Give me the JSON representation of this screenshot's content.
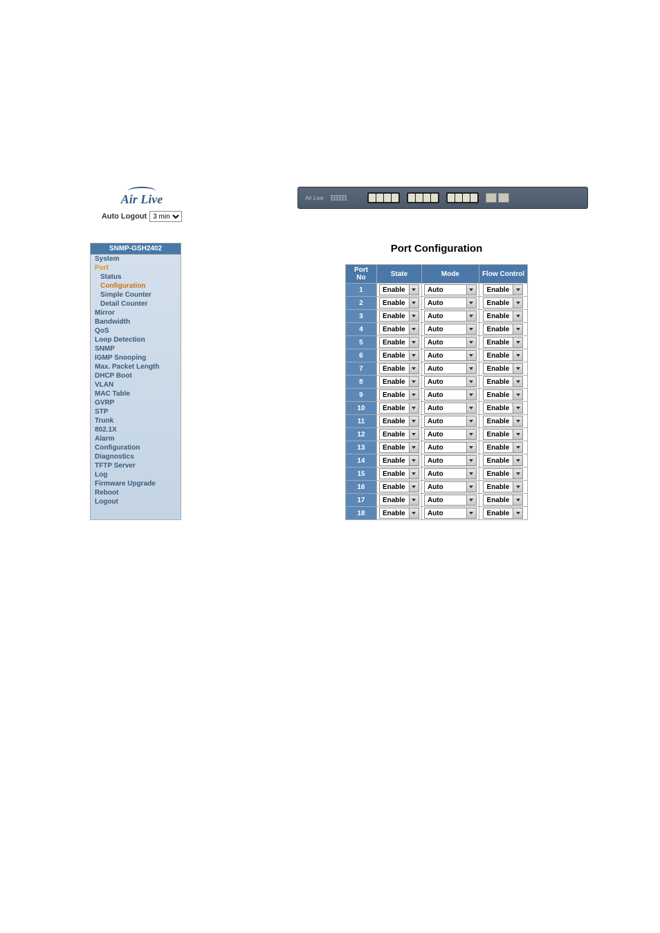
{
  "logo": {
    "brand": "Air Live",
    "auto_logout_label": "Auto Logout",
    "auto_logout_value": "3 min"
  },
  "device_bar": {
    "label": "Air Live"
  },
  "sidebar": {
    "header": "SNMP-GSH2402",
    "items": [
      {
        "label": "System",
        "indent": 0,
        "interact": true,
        "cls": ""
      },
      {
        "label": "Port",
        "indent": 0,
        "interact": true,
        "cls": "active-section"
      },
      {
        "label": "Status",
        "indent": 1,
        "interact": true,
        "cls": ""
      },
      {
        "label": "Configuration",
        "indent": 1,
        "interact": true,
        "cls": "active-page"
      },
      {
        "label": "Simple Counter",
        "indent": 1,
        "interact": true,
        "cls": ""
      },
      {
        "label": "Detail Counter",
        "indent": 1,
        "interact": true,
        "cls": ""
      },
      {
        "label": "Mirror",
        "indent": 0,
        "interact": true,
        "cls": ""
      },
      {
        "label": "Bandwidth",
        "indent": 0,
        "interact": true,
        "cls": ""
      },
      {
        "label": "QoS",
        "indent": 0,
        "interact": true,
        "cls": ""
      },
      {
        "label": "Loop Detection",
        "indent": 0,
        "interact": true,
        "cls": ""
      },
      {
        "label": "SNMP",
        "indent": 0,
        "interact": true,
        "cls": ""
      },
      {
        "label": "IGMP Snooping",
        "indent": 0,
        "interact": true,
        "cls": ""
      },
      {
        "label": "Max. Packet Length",
        "indent": 0,
        "interact": true,
        "cls": ""
      },
      {
        "label": "DHCP Boot",
        "indent": 0,
        "interact": true,
        "cls": ""
      },
      {
        "label": "VLAN",
        "indent": 0,
        "interact": true,
        "cls": ""
      },
      {
        "label": "MAC Table",
        "indent": 0,
        "interact": true,
        "cls": ""
      },
      {
        "label": "GVRP",
        "indent": 0,
        "interact": true,
        "cls": ""
      },
      {
        "label": "STP",
        "indent": 0,
        "interact": true,
        "cls": ""
      },
      {
        "label": "Trunk",
        "indent": 0,
        "interact": true,
        "cls": ""
      },
      {
        "label": "802.1X",
        "indent": 0,
        "interact": true,
        "cls": ""
      },
      {
        "label": "Alarm",
        "indent": 0,
        "interact": true,
        "cls": ""
      },
      {
        "label": "Configuration",
        "indent": 0,
        "interact": true,
        "cls": ""
      },
      {
        "label": "Diagnostics",
        "indent": 0,
        "interact": true,
        "cls": ""
      },
      {
        "label": "TFTP Server",
        "indent": 0,
        "interact": true,
        "cls": ""
      },
      {
        "label": "Log",
        "indent": 0,
        "interact": true,
        "cls": ""
      },
      {
        "label": "Firmware Upgrade",
        "indent": 0,
        "interact": true,
        "cls": ""
      },
      {
        "label": "Reboot",
        "indent": 0,
        "interact": true,
        "cls": ""
      },
      {
        "label": "Logout",
        "indent": 0,
        "interact": true,
        "cls": ""
      }
    ]
  },
  "content": {
    "title": "Port Configuration",
    "headers": {
      "port_no": "Port No",
      "state": "State",
      "mode": "Mode",
      "flow": "Flow Control"
    },
    "rows": [
      {
        "no": "1",
        "state": "Enable",
        "mode": "Auto",
        "flow": "Enable"
      },
      {
        "no": "2",
        "state": "Enable",
        "mode": "Auto",
        "flow": "Enable"
      },
      {
        "no": "3",
        "state": "Enable",
        "mode": "Auto",
        "flow": "Enable"
      },
      {
        "no": "4",
        "state": "Enable",
        "mode": "Auto",
        "flow": "Enable"
      },
      {
        "no": "5",
        "state": "Enable",
        "mode": "Auto",
        "flow": "Enable"
      },
      {
        "no": "6",
        "state": "Enable",
        "mode": "Auto",
        "flow": "Enable"
      },
      {
        "no": "7",
        "state": "Enable",
        "mode": "Auto",
        "flow": "Enable"
      },
      {
        "no": "8",
        "state": "Enable",
        "mode": "Auto",
        "flow": "Enable"
      },
      {
        "no": "9",
        "state": "Enable",
        "mode": "Auto",
        "flow": "Enable"
      },
      {
        "no": "10",
        "state": "Enable",
        "mode": "Auto",
        "flow": "Enable"
      },
      {
        "no": "11",
        "state": "Enable",
        "mode": "Auto",
        "flow": "Enable"
      },
      {
        "no": "12",
        "state": "Enable",
        "mode": "Auto",
        "flow": "Enable"
      },
      {
        "no": "13",
        "state": "Enable",
        "mode": "Auto",
        "flow": "Enable"
      },
      {
        "no": "14",
        "state": "Enable",
        "mode": "Auto",
        "flow": "Enable"
      },
      {
        "no": "15",
        "state": "Enable",
        "mode": "Auto",
        "flow": "Enable"
      },
      {
        "no": "16",
        "state": "Enable",
        "mode": "Auto",
        "flow": "Enable"
      },
      {
        "no": "17",
        "state": "Enable",
        "mode": "Auto",
        "flow": "Enable"
      },
      {
        "no": "18",
        "state": "Enable",
        "mode": "Auto",
        "flow": "Enable"
      }
    ]
  }
}
